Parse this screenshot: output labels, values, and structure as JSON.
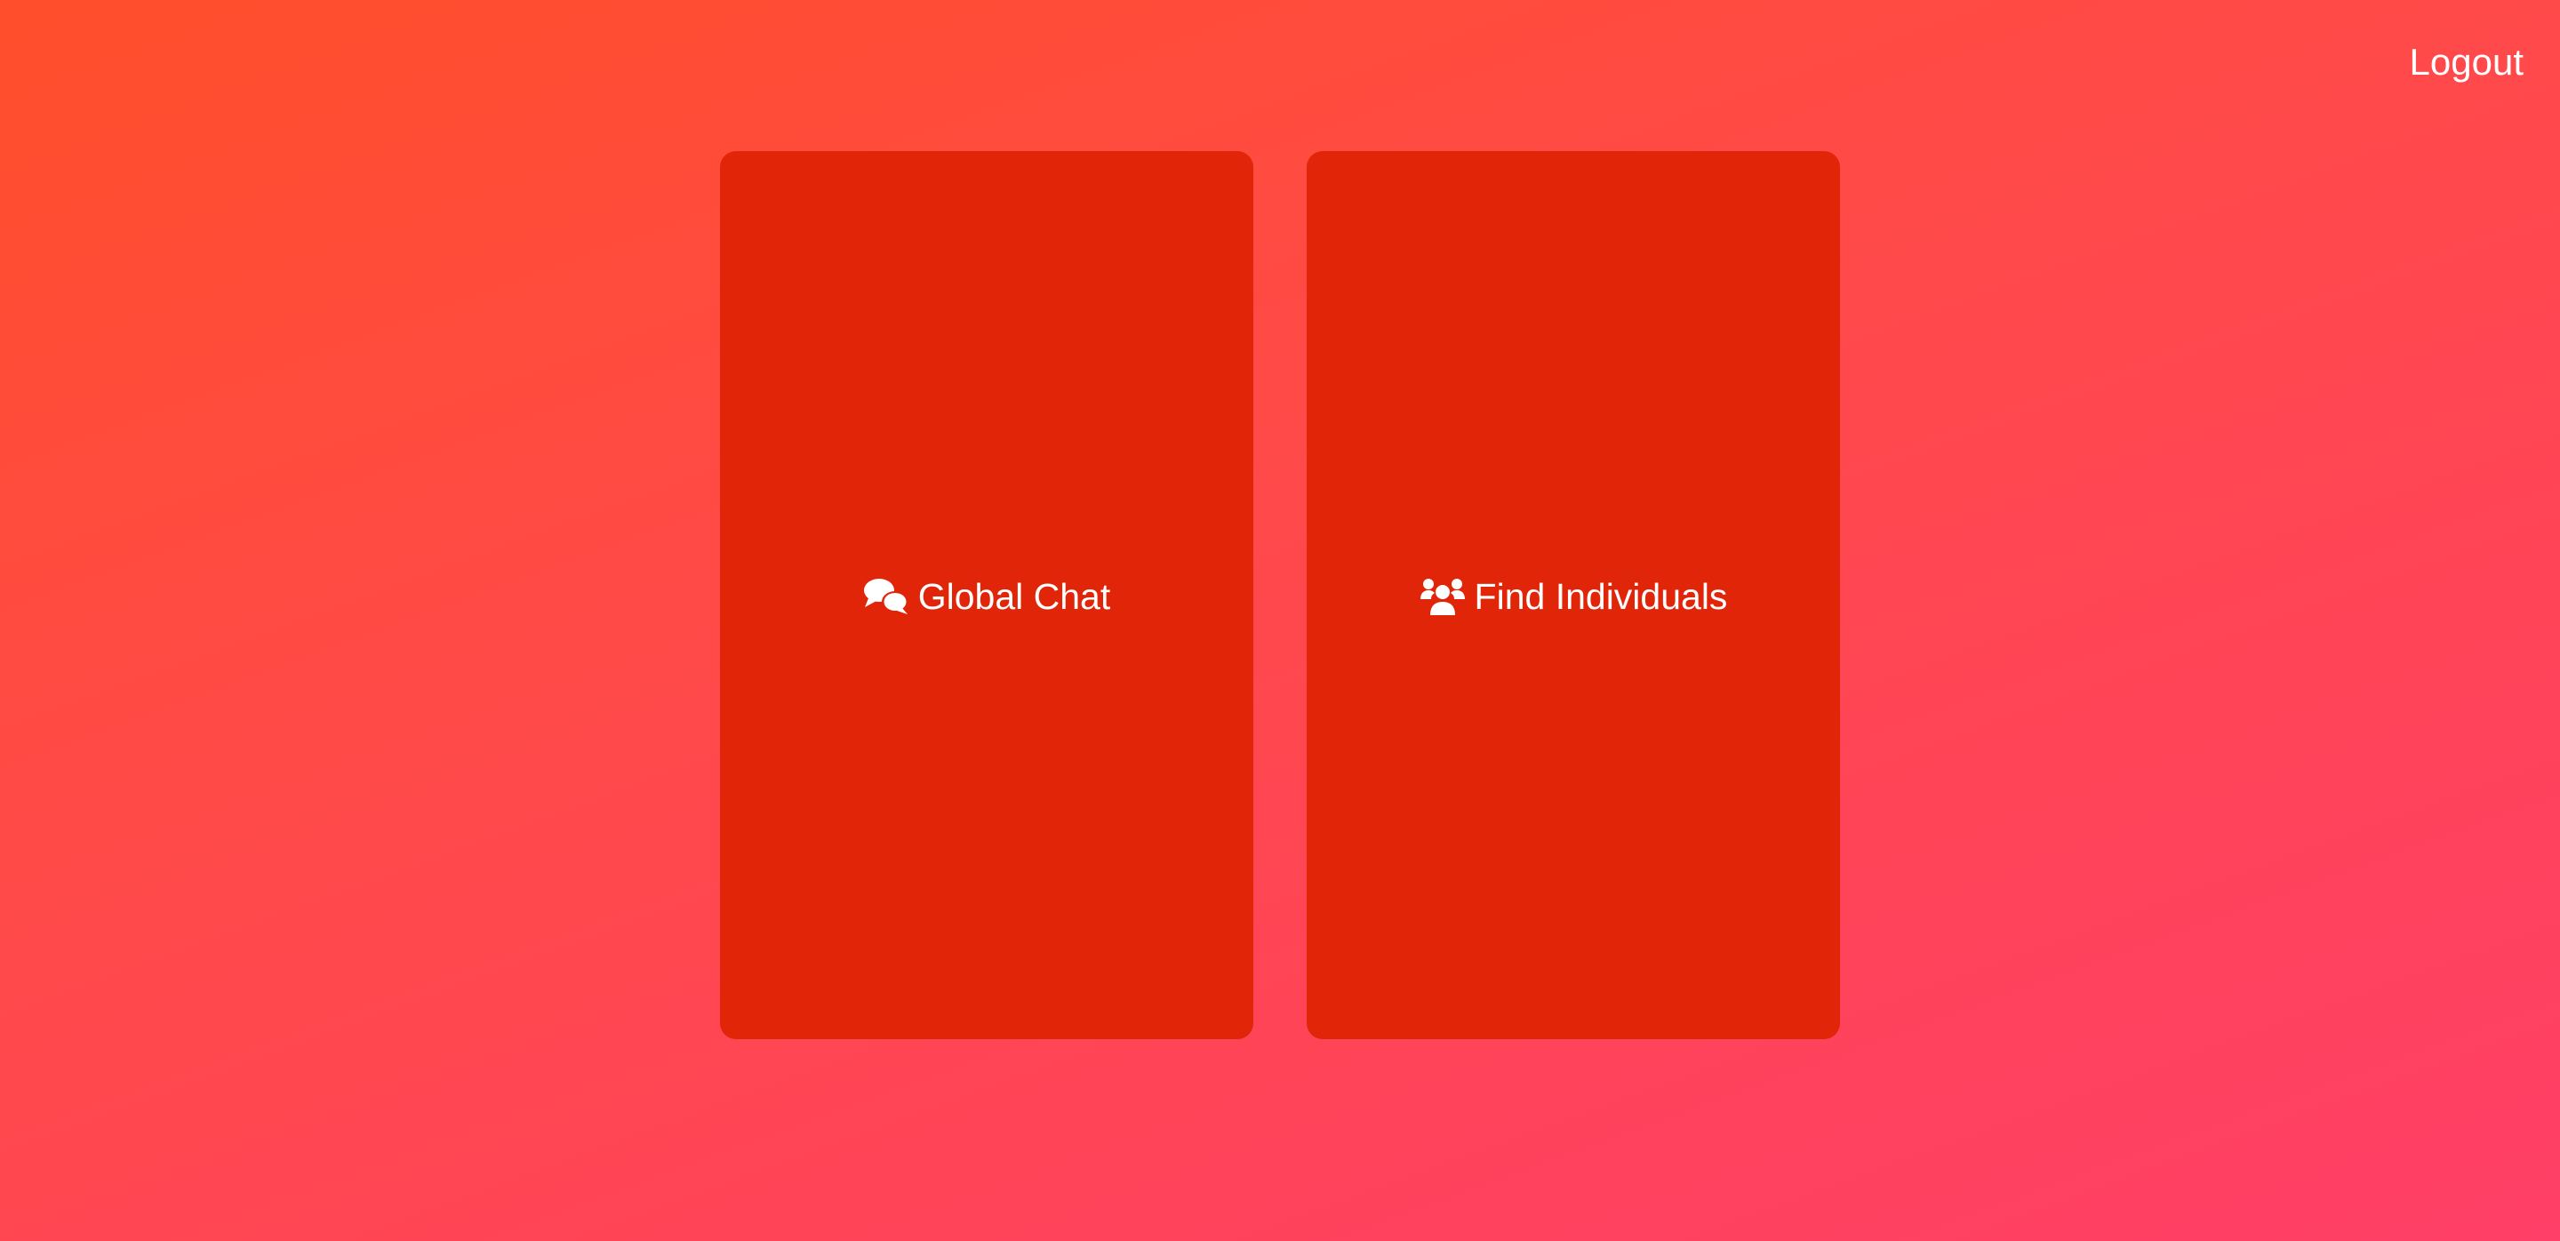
{
  "header": {
    "logout_label": "Logout"
  },
  "cards": [
    {
      "label": "Global Chat",
      "icon": "comments-icon"
    },
    {
      "label": "Find Individuals",
      "icon": "users-icon"
    }
  ],
  "colors": {
    "background_start": "#ff4e2b",
    "background_end": "#ff3f67",
    "card": "#e12508",
    "text": "#ffffff"
  }
}
